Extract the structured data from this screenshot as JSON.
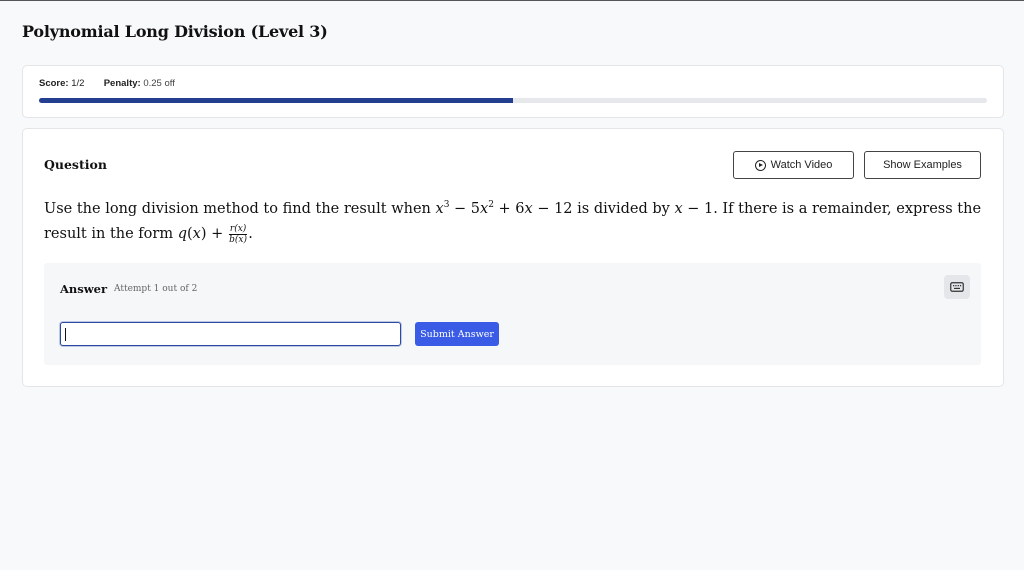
{
  "page": {
    "title": "Polynomial Long Division (Level 3)"
  },
  "score": {
    "score_label": "Score:",
    "score_value": "1/2",
    "penalty_label": "Penalty:",
    "penalty_value": "0.25 off",
    "progress_fraction": 0.5,
    "progress_color": "#243f8f"
  },
  "question": {
    "heading": "Question",
    "watch_video_label": "Watch Video",
    "watch_video_icon": "play-circle-icon",
    "show_examples_label": "Show Examples",
    "text_part1": "Use the long division method to find the result when ",
    "text_part2": " is divided by ",
    "text_part3": ". If there is a remainder, express the result in the form ",
    "frac_numerator": "r(x)",
    "frac_denominator": "b(x)"
  },
  "answer": {
    "label": "Answer",
    "attempt": "Attempt 1 out of 2",
    "input_value": "",
    "keyboard_icon": "keyboard-icon",
    "submit_label": "Submit Answer",
    "submit_color": "#3a5be6"
  }
}
